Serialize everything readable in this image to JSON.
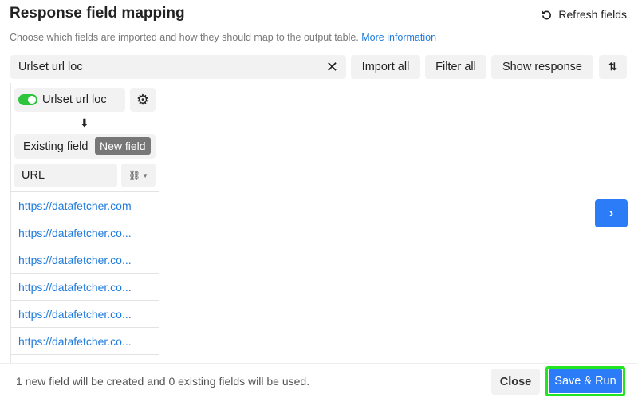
{
  "header": {
    "title": "Response field mapping",
    "refresh_label": "Refresh fields",
    "description": "Choose which fields are imported and how they should map to the output table.",
    "more_info_link": "More information"
  },
  "toolbar": {
    "search_value": "Urlset url loc",
    "import_all": "Import all",
    "filter_all": "Filter all",
    "show_response": "Show response"
  },
  "field": {
    "name": "Urlset url loc",
    "enabled": true,
    "mode_existing": "Existing field",
    "mode_new": "New field",
    "output_name": "URL",
    "values": [
      "https://datafetcher.com",
      "https://datafetcher.co...",
      "https://datafetcher.co...",
      "https://datafetcher.co...",
      "https://datafetcher.co...",
      "https://datafetcher.co..."
    ]
  },
  "footer": {
    "status": "1 new field will be created and 0 existing fields will be used.",
    "close": "Close",
    "save_run": "Save & Run"
  },
  "colors": {
    "accent": "#2b7cf6",
    "toggle_on": "#2cc53b",
    "focus_outline": "#22e522"
  }
}
